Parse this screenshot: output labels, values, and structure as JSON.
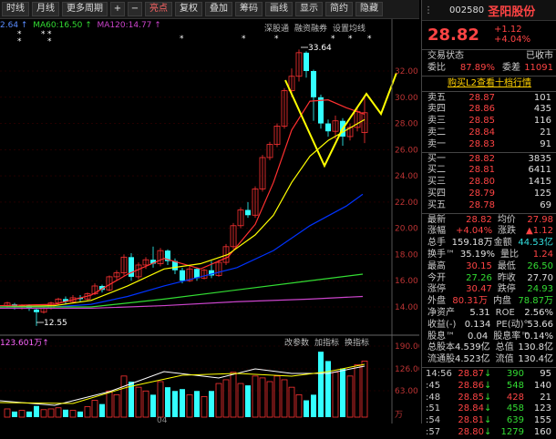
{
  "toolbar": {
    "btn_line": "时线",
    "btn_month": "月线",
    "btn_more": "更多周期",
    "btn_plus": "+",
    "btn_minus": "−",
    "btn_bright": "亮点",
    "btn_restore": "复权",
    "btn_overlay": "叠加",
    "btn_chip": "筹码",
    "btn_draw": "画线",
    "btn_display": "显示",
    "btn_simple": "简约",
    "btn_hide": "隐藏"
  },
  "legend": {
    "ma_a": "2.64 ↑",
    "ma60": "MA60:16.50 ↑",
    "ma120": "MA120:14.77 ↑"
  },
  "subtabs": [
    "深股通",
    "融资融券",
    "设置均线"
  ],
  "annotations": {
    "high_label": "33.64",
    "low_label": "12.55"
  },
  "y_ticks": [
    "32.00",
    "30.00",
    "28.00",
    "26.00",
    "24.00",
    "22.00",
    "20.00",
    "18.00",
    "16.00",
    "14.00"
  ],
  "vol_ticks": [
    "190.00",
    "126.00",
    "63.00",
    "万"
  ],
  "vol_legend": "123.601万↑",
  "vol_tabs": [
    "改参数",
    "加指标",
    "换指标"
  ],
  "x_label": "04",
  "colors": {
    "up": "#ff3333",
    "down": "#33ffff",
    "ma5": "#ffffff",
    "ma10": "#ffff00",
    "ma20": "#ff3030",
    "ma30": "#0033ff",
    "ma60": "#33dd33",
    "ma120": "#cc44cc"
  },
  "quote": {
    "code": "002580",
    "name": "圣阳股份",
    "price": "28.82",
    "change": "+1.12",
    "change_pct": "+4.04%",
    "status_label": "交易状态",
    "status_value": "已收市",
    "ratio_label": "委比",
    "ratio_value": "87.89%",
    "diff_label": "委差",
    "diff_value": "11091",
    "l2_link": "购买L2查看十档行情"
  },
  "sells": [
    {
      "label": "卖五",
      "price": "28.87",
      "vol": "101"
    },
    {
      "label": "卖四",
      "price": "28.86",
      "vol": "435"
    },
    {
      "label": "卖三",
      "price": "28.85",
      "vol": "116"
    },
    {
      "label": "卖二",
      "price": "28.84",
      "vol": "21"
    },
    {
      "label": "卖一",
      "price": "28.83",
      "vol": "91"
    }
  ],
  "buys": [
    {
      "label": "买一",
      "price": "28.82",
      "vol": "3835"
    },
    {
      "label": "买二",
      "price": "28.81",
      "vol": "6411"
    },
    {
      "label": "买三",
      "price": "28.80",
      "vol": "1415"
    },
    {
      "label": "买四",
      "price": "28.79",
      "vol": "125"
    },
    {
      "label": "买五",
      "price": "28.78",
      "vol": "69"
    }
  ],
  "stats": [
    {
      "l1": "最新",
      "v1": "28.82",
      "c1": "red",
      "l2": "均价",
      "v2": "27.98",
      "c2": "red"
    },
    {
      "l1": "涨幅",
      "v1": "+4.04%",
      "c1": "red",
      "l2": "涨跌",
      "v2": "▲1.12",
      "c2": "red"
    },
    {
      "l1": "总手",
      "v1": "159.18万",
      "c1": "white",
      "l2": "金额",
      "v2": "44.53亿",
      "c2": "cyan"
    },
    {
      "l1": "换手™",
      "v1": "35.19%",
      "c1": "white",
      "l2": "量比",
      "v2": "1.24",
      "c2": "red"
    },
    {
      "l1": "最高",
      "v1": "30.15",
      "c1": "red",
      "l2": "最低",
      "v2": "26.50",
      "c2": "green"
    },
    {
      "l1": "今开",
      "v1": "27.26",
      "c1": "green",
      "l2": "昨收",
      "v2": "27.70",
      "c2": "white"
    },
    {
      "l1": "涨停",
      "v1": "30.47",
      "c1": "red",
      "l2": "跌停",
      "v2": "24.93",
      "c2": "green"
    },
    {
      "l1": "外盘",
      "v1": "80.31万",
      "c1": "red",
      "l2": "内盘",
      "v2": "78.87万",
      "c2": "green"
    },
    {
      "l1": "净资产",
      "v1": "5.31",
      "c1": "white",
      "l2": "ROE",
      "v2": "2.56%",
      "c2": "white"
    },
    {
      "l1": "收益(-)",
      "v1": "0.134",
      "c1": "white",
      "l2": "PE(动)°",
      "v2": "53.66",
      "c2": "white"
    },
    {
      "l1": "股息™",
      "v1": "0.04",
      "c1": "white",
      "l2": "股息率™",
      "v2": "0.14%",
      "c2": "white"
    },
    {
      "l1": "总股本",
      "v1": "4.539亿",
      "c1": "white",
      "l2": "总值",
      "v2": "130.8亿",
      "c2": "white"
    },
    {
      "l1": "流通股",
      "v1": "4.523亿",
      "c1": "white",
      "l2": "流值",
      "v2": "130.4亿",
      "c2": "white"
    }
  ],
  "ticks": [
    {
      "time": "14:56",
      "price": "28.87",
      "arrow": "↓",
      "vol": "390",
      "num": "95",
      "pc": "red",
      "ac": "green",
      "vc": "green"
    },
    {
      "time": ":45",
      "price": "28.86",
      "arrow": "↓",
      "vol": "548",
      "num": "140",
      "pc": "red",
      "ac": "green",
      "vc": "green"
    },
    {
      "time": ":48",
      "price": "28.85",
      "arrow": "↓",
      "vol": "428",
      "num": "21",
      "pc": "red",
      "ac": "green",
      "vc": "red"
    },
    {
      "time": ":51",
      "price": "28.84",
      "arrow": "↓",
      "vol": "458",
      "num": "123",
      "pc": "red",
      "ac": "green",
      "vc": "green"
    },
    {
      "time": ":54",
      "price": "28.81",
      "arrow": "↓",
      "vol": "639",
      "num": "155",
      "pc": "red",
      "ac": "green",
      "vc": "green"
    },
    {
      "time": ":57",
      "price": "28.80",
      "arrow": "↓",
      "vol": "1279",
      "num": "160",
      "pc": "red",
      "ac": "green",
      "vc": "green"
    }
  ]
}
